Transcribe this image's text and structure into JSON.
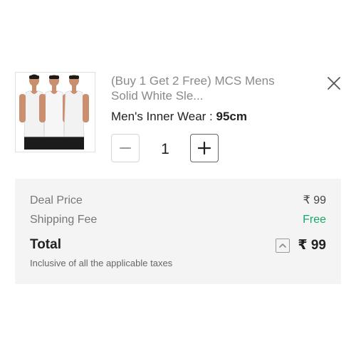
{
  "product": {
    "title": "(Buy 1 Get 2 Free) MCS Mens Solid White Sle...",
    "variant_label": "Men's Inner Wear : ",
    "variant_value": "95cm",
    "image_icon": "product-vests-image"
  },
  "quantity": {
    "value": "1",
    "minus_icon": "minus-icon",
    "plus_icon": "plus-icon"
  },
  "close_icon": "close-icon",
  "summary": {
    "deal_price_label": "Deal Price",
    "deal_price_value": "₹ 99",
    "shipping_label": "Shipping Fee",
    "shipping_value": "Free",
    "total_label": "Total",
    "total_value": "₹ 99",
    "expand_icon": "chevron-up-icon",
    "tax_note": "Inclusive of all the applicable taxes"
  },
  "colors": {
    "free": "#1aa86a",
    "summary_bg": "#f4f4f4"
  }
}
